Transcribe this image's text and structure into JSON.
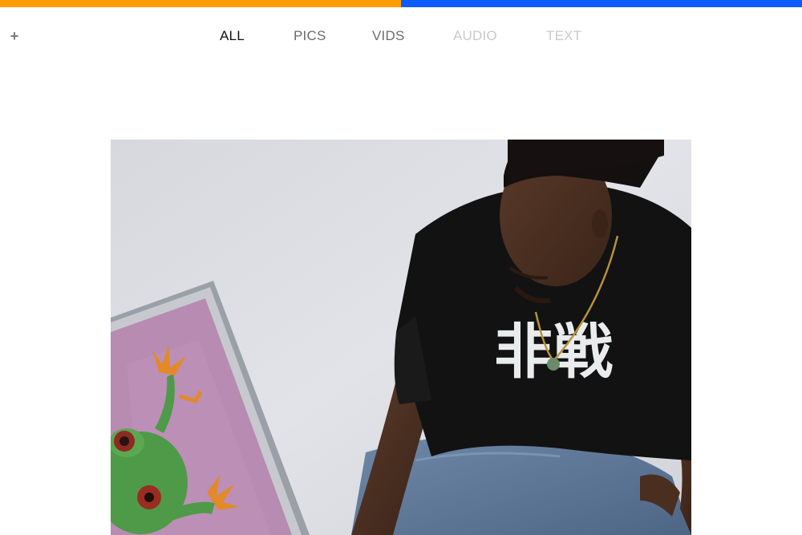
{
  "top_bar": {
    "colors": [
      "#ff9c00",
      "#0a5cff"
    ]
  },
  "header": {
    "add_button_label": "+"
  },
  "nav": {
    "tabs": [
      {
        "label": "ALL",
        "color": "#111111"
      },
      {
        "label": "PICS",
        "color": "#6b6b6b"
      },
      {
        "label": "VIDS",
        "color": "#6b6b6b"
      },
      {
        "label": "AUDIO",
        "color": "#c9c9c9"
      },
      {
        "label": "TEXT",
        "color": "#c9c9c9"
      }
    ]
  },
  "main": {
    "photo": {
      "shirt_text": "非戦"
    }
  }
}
